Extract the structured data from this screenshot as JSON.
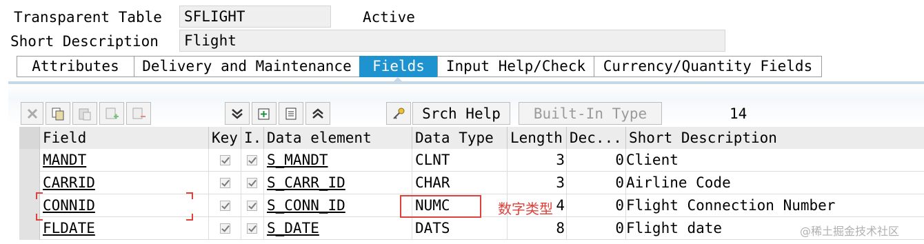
{
  "header": {
    "table_label": "Transparent Table",
    "table_name": "SFLIGHT",
    "status": "Active",
    "short_desc_label": "Short Description",
    "short_desc_value": "Flight"
  },
  "tabs": [
    {
      "label": "Attributes",
      "active": false
    },
    {
      "label": "Delivery and Maintenance",
      "active": false
    },
    {
      "label": "Fields",
      "active": true
    },
    {
      "label": "Input Help/Check",
      "active": false
    },
    {
      "label": "Currency/Quantity Fields",
      "active": false
    }
  ],
  "toolbar": {
    "icons": [
      "cut-icon",
      "copy-icon",
      "paste-icon",
      "insert-row-icon",
      "delete-row-icon",
      "collapse-icon",
      "new-entry-icon",
      "list-icon",
      "expand-icon",
      "key-icon"
    ],
    "srch_help": "Srch Help",
    "builtin_type": "Built-In Type",
    "field_count": "14"
  },
  "table": {
    "columns": [
      "Field",
      "Key",
      "I...",
      "Data element",
      "Data Type",
      "Length",
      "Dec...",
      "Short Description"
    ],
    "rows": [
      {
        "field": "MANDT",
        "data_element": "S_MANDT",
        "data_type": "CLNT",
        "length": "3",
        "decimals": "0",
        "short_desc": "Client"
      },
      {
        "field": "CARRID",
        "data_element": "S_CARR_ID",
        "data_type": "CHAR",
        "length": "3",
        "decimals": "0",
        "short_desc": "Airline Code"
      },
      {
        "field": "CONNID",
        "data_element": "S_CONN_ID",
        "data_type": "NUMC",
        "length": "4",
        "decimals": "0",
        "short_desc": "Flight Connection Number"
      },
      {
        "field": "FLDATE",
        "data_element": "S_DATE",
        "data_type": "DATS",
        "length": "8",
        "decimals": "0",
        "short_desc": "Flight date"
      }
    ]
  },
  "annotation": "数字类型",
  "watermark": "@稀土掘金技术社区",
  "colors": {
    "active_tab": "#1f93d0",
    "annotation": "#e0403a"
  }
}
